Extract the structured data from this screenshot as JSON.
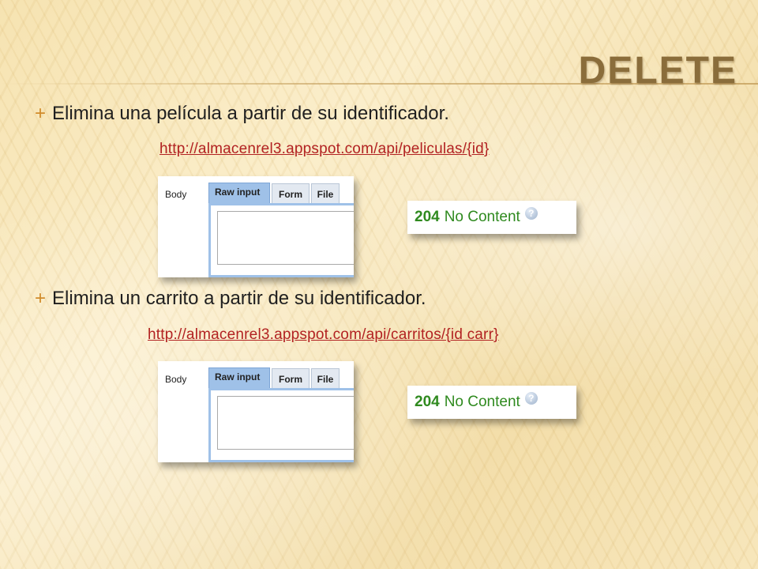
{
  "slide": {
    "title": "DELETE",
    "sections": [
      {
        "bullet": "Elimina una película a partir de su identificador.",
        "url": "http://almacenrel3.appspot.com/api/peliculas/{id}",
        "panel": {
          "body_label": "Body",
          "tabs": [
            "Raw input",
            "Form",
            "File"
          ],
          "active_tab": "Raw input",
          "textarea_value": ""
        },
        "status": {
          "code": "204",
          "message": "No Content",
          "icon": "help-icon"
        }
      },
      {
        "bullet": "Elimina un carrito a partir de su identificador.",
        "url": "http://almacenrel3.appspot.com/api/carritos/{id carr}",
        "panel": {
          "body_label": "Body",
          "tabs": [
            "Raw input",
            "Form",
            "File"
          ],
          "active_tab": "Raw input",
          "textarea_value": ""
        },
        "status": {
          "code": "204",
          "message": "No Content",
          "icon": "help-icon"
        }
      }
    ],
    "colors": {
      "title": "#8a6d3b",
      "bullet_marker": "#d18b2a",
      "link": "#b22222",
      "status_ok": "#2f8a1f",
      "active_tab": "#9fc1e8"
    }
  }
}
